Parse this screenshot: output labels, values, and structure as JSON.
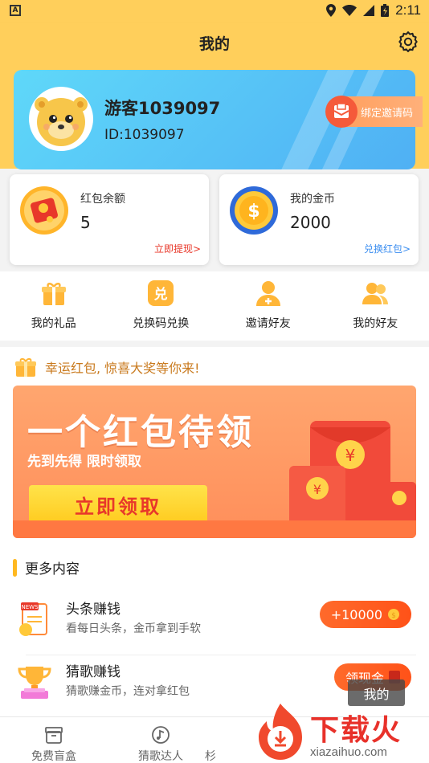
{
  "status_bar": {
    "time": "2:11"
  },
  "header": {
    "title": "我的"
  },
  "profile": {
    "username": "游客1039097",
    "user_id": "ID:1039097",
    "bind_invite_label": "绑定邀请码"
  },
  "wallet": {
    "red_packet": {
      "label": "红包余额",
      "value": "5",
      "link": "立即提现>"
    },
    "coins": {
      "label": "我的金币",
      "value": "2000",
      "link": "兑换红包>"
    }
  },
  "quick_actions": [
    {
      "label": "我的礼品",
      "icon": "gift-icon"
    },
    {
      "label": "兑换码兑换",
      "icon": "redeem-code-icon"
    },
    {
      "label": "邀请好友",
      "icon": "invite-friend-icon"
    },
    {
      "label": "我的好友",
      "icon": "friends-icon"
    }
  ],
  "lucky": {
    "text": "幸运红包, 惊喜大奖等你来!"
  },
  "banner": {
    "title": "一个红包待领",
    "subtitle": "先到先得 限时领取",
    "button_label": "立即领取"
  },
  "more_section": {
    "title": "更多内容"
  },
  "tasks": [
    {
      "title": "头条赚钱",
      "desc": "看每日头条，金币拿到手软",
      "button": "+10000"
    },
    {
      "title": "猜歌赚钱",
      "desc": "猜歌赚金币，连对拿红包",
      "button": "领现金"
    }
  ],
  "tooltip": {
    "text": "我的"
  },
  "tab_bar": {
    "tabs": [
      {
        "label": "免费盲盒",
        "icon": "box-icon"
      },
      {
        "label": "猜歌达人",
        "icon": "music-disc-icon"
      },
      {
        "label": "杉",
        "icon": "tab-icon"
      }
    ]
  },
  "watermark": {
    "text": "下载火",
    "url": "xiazaihuo.com"
  },
  "colors": {
    "accent": "#ffcf5b",
    "primary_red": "#ff5a1f",
    "link_red": "#e8382a",
    "link_blue": "#3b8ef0"
  }
}
